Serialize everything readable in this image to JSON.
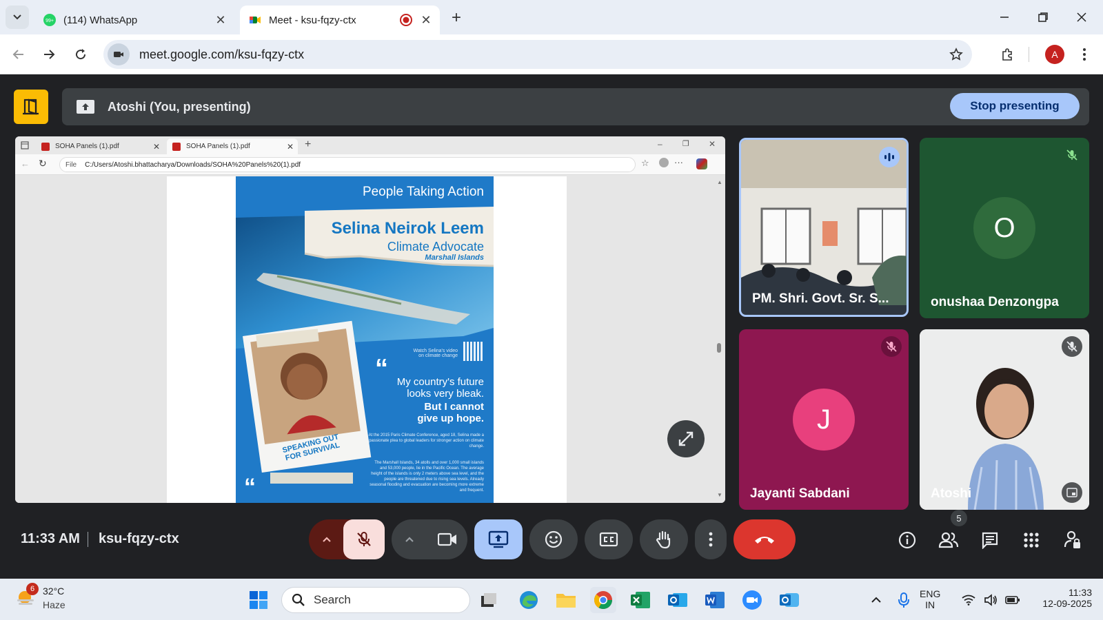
{
  "browser": {
    "tabs": [
      {
        "title": "(114) WhatsApp",
        "badge": "99+"
      },
      {
        "title": "Meet - ksu-fqzy-ctx"
      }
    ],
    "url": "meet.google.com/ksu-fqzy-ctx",
    "profile_initial": "A"
  },
  "meet": {
    "presenting_label": "Atoshi (You, presenting)",
    "stop_button": "Stop presenting",
    "time": "11:33 AM",
    "meeting_code": "ksu-fqzy-ctx",
    "people_count": "5",
    "participants": [
      {
        "name": "PM. Shri. Govt. Sr. S..."
      },
      {
        "name": "onushaa Denzongpa",
        "initial": "O",
        "color": "#1e5631"
      },
      {
        "name": "Jayanti Sabdani",
        "initial": "J",
        "color": "#a0195a"
      },
      {
        "name": "Atoshi"
      }
    ]
  },
  "shared_screen": {
    "tabs": [
      "SOHA Panels (1).pdf",
      "SOHA Panels (1).pdf"
    ],
    "file_label": "File",
    "path": "C:/Users/Atoshi.bhattacharya/Downloads/SOHA%20Panels%20(1).pdf",
    "poster": {
      "header": "People Taking Action",
      "name": "Selina Neirok Leem",
      "role": "Climate Advocate",
      "location": "Marshall Islands",
      "watch": "Watch Selina's video on climate change",
      "quote_line1": "My country's future",
      "quote_line2": "looks very bleak.",
      "quote_line3": "But I cannot",
      "quote_line4": "give up hope.",
      "para1": "At the 2015 Paris Climate Conference, aged 18, Selina made a passionate plea to global leaders for stronger action on climate change.",
      "para2": "The Marshall Islands, 34 atolls and over 1,000 small islands and 53,000 people, lie in the Pacific Ocean. The average height of the islands is only 2 meters above sea level, and the people are threatened due to rising sea levels. Already seasonal flooding and evacuation are becoming more extreme and frequent.",
      "tag_line1": "SPEAKING OUT",
      "tag_line2": "FOR SURVIVAL"
    }
  },
  "taskbar": {
    "weather_badge": "6",
    "temperature": "32°C",
    "condition": "Haze",
    "search_placeholder": "Search",
    "lang1": "ENG",
    "lang2": "IN",
    "time": "11:33",
    "date": "12-09-2025"
  }
}
